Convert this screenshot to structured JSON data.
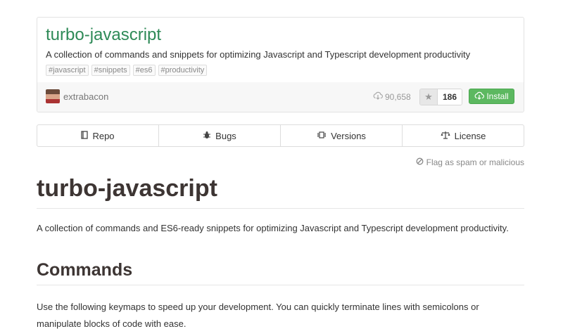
{
  "package": {
    "name": "turbo-javascript",
    "description": "A collection of commands and snippets for optimizing Javascript and Typescript development productivity",
    "tags": [
      "#javascript",
      "#snippets",
      "#es6",
      "#productivity"
    ],
    "author": "extrabacon",
    "downloads": "90,658",
    "stars": "186",
    "install_label": "Install"
  },
  "nav": {
    "items": [
      {
        "label": "Repo",
        "icon": "book-icon"
      },
      {
        "label": "Bugs",
        "icon": "bug-icon"
      },
      {
        "label": "Versions",
        "icon": "versions-icon"
      },
      {
        "label": "License",
        "icon": "scale-icon"
      }
    ]
  },
  "flag_label": "Flag as spam or malicious",
  "readme": {
    "title": "turbo-javascript",
    "intro": "A collection of commands and ES6-ready snippets for optimizing Javascript and Typescript development productivity.",
    "section_title": "Commands",
    "section_text": "Use the following keymaps to speed up your development. You can quickly terminate lines with semicolons or manipulate blocks of code with ease."
  },
  "colors": {
    "title_green": "#2e8a57",
    "install_green": "#5cb860"
  }
}
